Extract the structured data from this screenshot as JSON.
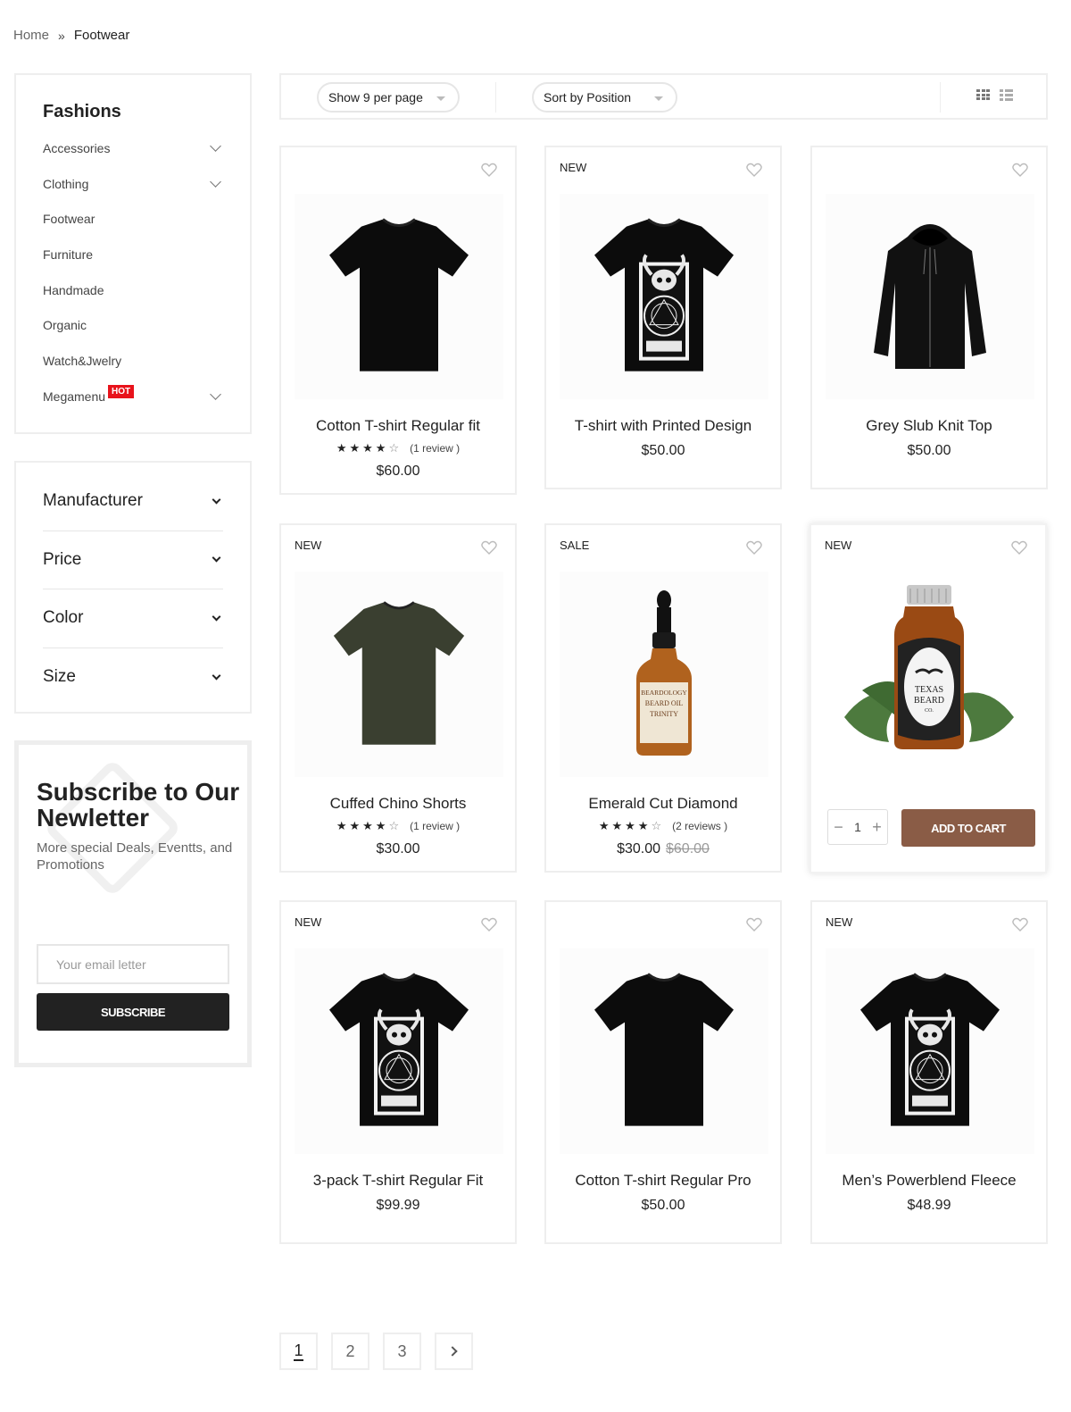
{
  "breadcrumb": {
    "home": "Home",
    "separator": "»",
    "current": "Footwear"
  },
  "sidebar": {
    "categories_title": "Fashions",
    "categories": [
      {
        "label": "Accessories",
        "expandable": true
      },
      {
        "label": "Clothing",
        "expandable": true
      },
      {
        "label": "Footwear",
        "expandable": false
      },
      {
        "label": "Furniture",
        "expandable": false
      },
      {
        "label": "Handmade",
        "expandable": false
      },
      {
        "label": "Organic",
        "expandable": false
      },
      {
        "label": "Watch&Jwelry",
        "expandable": false
      },
      {
        "label": "Megamenu",
        "expandable": true,
        "badge": "HOT"
      }
    ],
    "filters": [
      "Manufacturer",
      "Price",
      "Color",
      "Size"
    ],
    "subscribe": {
      "title": "Subscribe to Our Newletter",
      "description": "More special Deals, Eventts, and Promotions",
      "placeholder": "Your email letter",
      "button": "SUBSCRIBE"
    }
  },
  "toolbar": {
    "show_label": "Show 9 per page",
    "sort_label": "Sort by Position",
    "view_modes": [
      "grid-icon",
      "list-icon"
    ]
  },
  "products": [
    {
      "name": "Cotton T-shirt Regular fit",
      "badge": "",
      "price": "$60.00",
      "old_price": "",
      "rating": 4,
      "reviews": "(1  review )",
      "image": "black-tshirt"
    },
    {
      "name": "T-shirt with Printed Design",
      "badge": "NEW",
      "price": "$50.00",
      "old_price": "",
      "rating": 0,
      "reviews": "",
      "image": "printed-tshirt"
    },
    {
      "name": "Grey Slub Knit Top",
      "badge": "",
      "price": "$50.00",
      "old_price": "",
      "rating": 0,
      "reviews": "",
      "image": "black-hoodie"
    },
    {
      "name": "Cuffed Chino Shorts",
      "badge": "NEW",
      "price": "$30.00",
      "old_price": "",
      "rating": 4,
      "reviews": "(1  review )",
      "image": "olive-tshirt"
    },
    {
      "name": "Emerald Cut Diamond",
      "badge": "SALE",
      "price": "$30.00",
      "old_price": "$60.00",
      "rating": 4,
      "reviews": "(2  reviews )",
      "image": "dropper-bottle"
    },
    {
      "name": "",
      "badge": "NEW",
      "price": "",
      "old_price": "",
      "rating": 0,
      "reviews": "",
      "image": "beard-oil-bottle",
      "hovered": true,
      "quantity": "1",
      "cart_button": "ADD TO CART"
    },
    {
      "name": "3-pack T-shirt Regular Fit",
      "badge": "NEW",
      "price": "$99.99",
      "old_price": "",
      "rating": 0,
      "reviews": "",
      "image": "printed-tshirt"
    },
    {
      "name": "Cotton T-shirt Regular Pro",
      "badge": "",
      "price": "$50.00",
      "old_price": "",
      "rating": 0,
      "reviews": "",
      "image": "black-tshirt"
    },
    {
      "name": "Men’s Powerblend Fleece",
      "badge": "NEW",
      "price": "$48.99",
      "old_price": "",
      "rating": 0,
      "reviews": "",
      "image": "printed-tshirt"
    }
  ],
  "bottle_label": {
    "line1": "TEXAS",
    "line2": "BEARD",
    "line3": "CO."
  },
  "dropper_label": {
    "line1": "BEARDOLOGY",
    "line2": "BEARD OIL",
    "line3": "TRINITY"
  },
  "pagination": {
    "pages": [
      "1",
      "2",
      "3"
    ],
    "current": "1"
  },
  "colors": {
    "accent": "#8a5c46",
    "hot_badge": "#e8131b",
    "dark_button": "#222222"
  }
}
